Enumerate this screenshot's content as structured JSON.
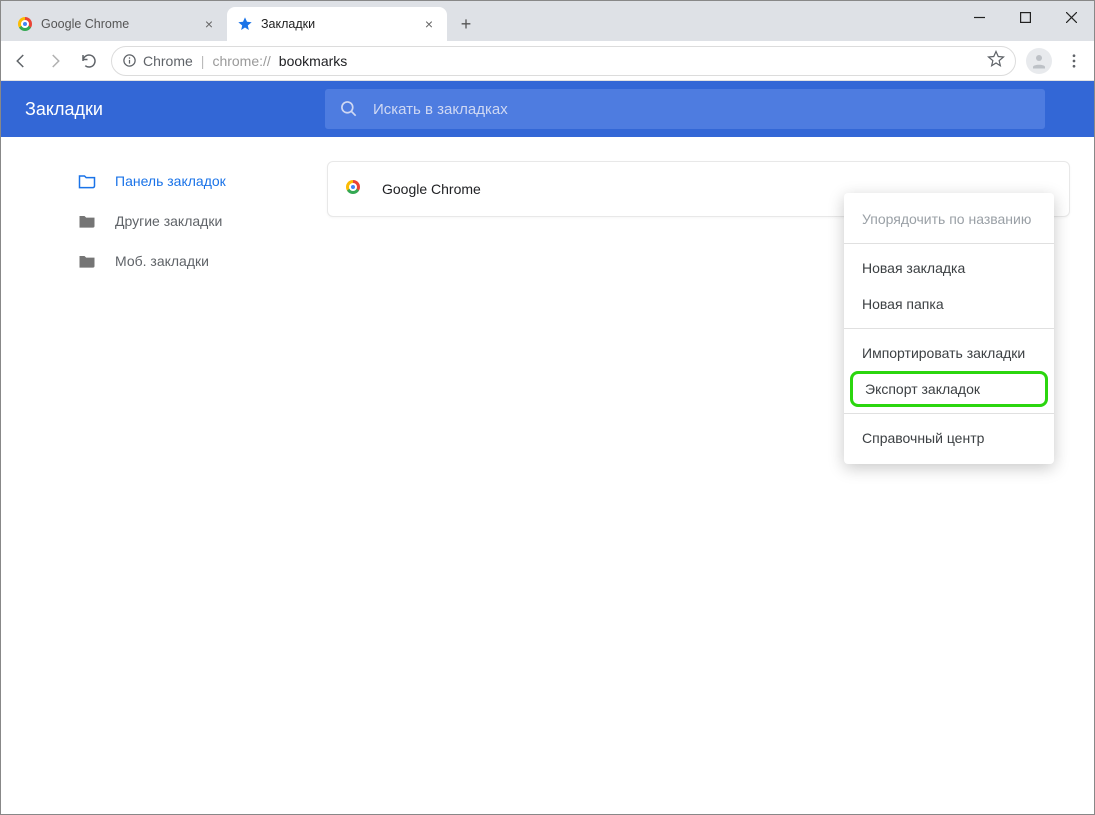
{
  "tabs": [
    {
      "title": "Google Chrome",
      "icon": "chrome"
    },
    {
      "title": "Закладки",
      "icon": "star"
    }
  ],
  "addressbar": {
    "chip_icon": "info",
    "chip_label": "Chrome",
    "url_prefix": "chrome://",
    "url_path": "bookmarks"
  },
  "header": {
    "title": "Закладки"
  },
  "search": {
    "placeholder": "Искать в закладках"
  },
  "sidebar": {
    "items": [
      {
        "label": "Панель закладок",
        "active": true
      },
      {
        "label": "Другие закладки",
        "active": false
      },
      {
        "label": "Моб. закладки",
        "active": false
      }
    ]
  },
  "bookmarks": [
    {
      "title": "Google Chrome",
      "icon": "chrome"
    }
  ],
  "menu": {
    "items": [
      {
        "label": "Упорядочить по названию",
        "disabled": true
      },
      {
        "sep": true
      },
      {
        "label": "Новая закладка"
      },
      {
        "label": "Новая папка"
      },
      {
        "sep": true
      },
      {
        "label": "Импортировать закладки"
      },
      {
        "label": "Экспорт закладок",
        "highlight": true
      },
      {
        "sep": true
      },
      {
        "label": "Справочный центр"
      }
    ]
  }
}
